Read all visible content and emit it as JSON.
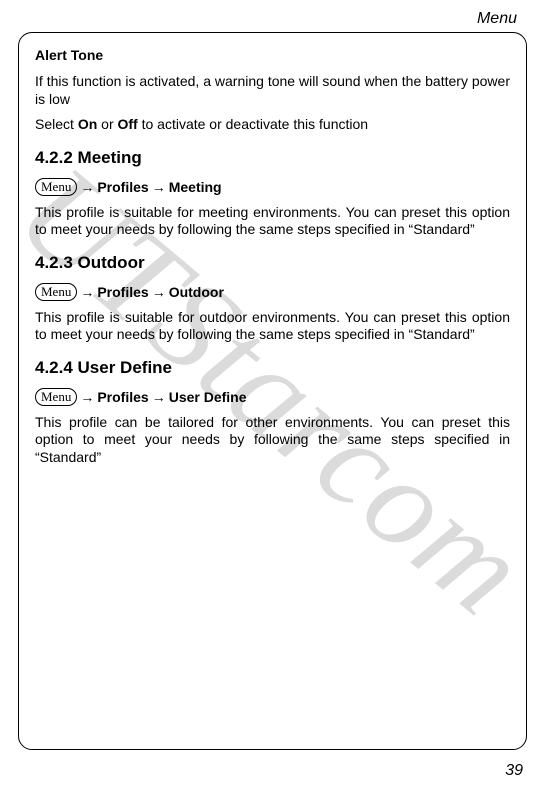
{
  "header": {
    "section_title": "Menu"
  },
  "menu_button_label": "Menu",
  "arrow": "→",
  "alert_tone": {
    "heading": "Alert Tone",
    "p1_pre": "If this function is activated, a warning tone will sound when the battery power is low",
    "p2_pre": "Select ",
    "p2_on": "On",
    "p2_mid": " or ",
    "p2_off": "Off",
    "p2_post": " to activate or deactivate this function"
  },
  "s422": {
    "heading": "4.2.2 Meeting",
    "nav1": "Profiles",
    "nav2": "Meeting",
    "body": "This profile is suitable for meeting environments. You can preset this option to meet your needs by following the same steps specified in “Standard”"
  },
  "s423": {
    "heading": "4.2.3 Outdoor",
    "nav1": "Profiles",
    "nav2": "Outdoor",
    "body": "This profile is suitable for outdoor environments. You can preset this option to meet your needs by following the same steps specified in “Standard”"
  },
  "s424": {
    "heading": "4.2.4 User Define",
    "nav1": "Profiles",
    "nav2": "User Define",
    "body": "This profile can be tailored for other environments. You can preset this option to meet your needs by following the same steps specified in “Standard”"
  },
  "watermark": "UTStarcom",
  "page_number": "39"
}
